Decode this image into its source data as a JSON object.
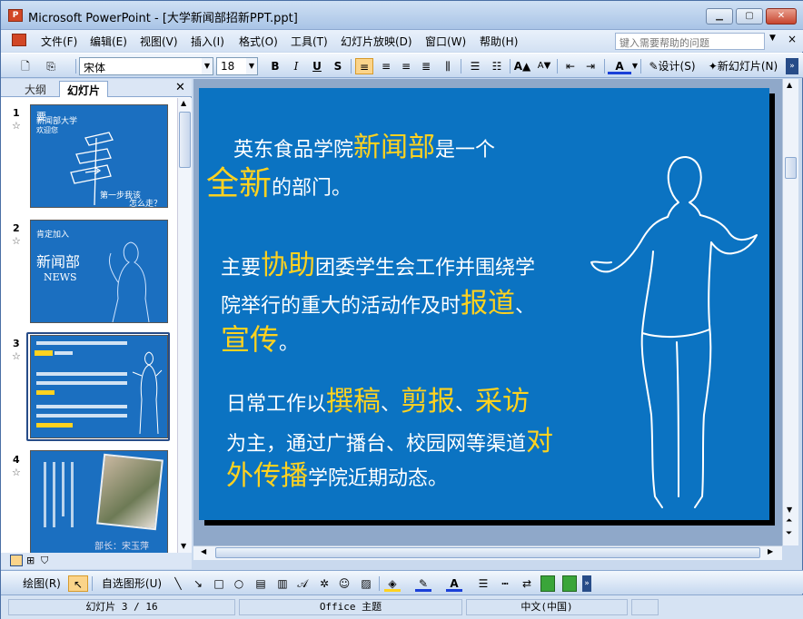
{
  "window": {
    "title": "Microsoft PowerPoint - [大学新闻部招新PPT.ppt]",
    "app_icon": "P"
  },
  "menu": {
    "items": [
      "文件(F)",
      "编辑(E)",
      "视图(V)",
      "插入(I)",
      "格式(O)",
      "工具(T)",
      "幻灯片放映(D)",
      "窗口(W)",
      "帮助(H)"
    ],
    "help_placeholder": "键入需要帮助的问题"
  },
  "toolbar": {
    "font": "宋体",
    "size": "18",
    "design": "设计(S)",
    "new_slide": "新幻灯片(N)"
  },
  "panel": {
    "tab_outline": "大纲",
    "tab_slides": "幻灯片"
  },
  "thumbs": {
    "t1_top": "要",
    "t1_line1": "新闻部大学",
    "t1_line2": "欢迎您",
    "t1_bottom1": "第一步我该",
    "t1_bottom2": "怎么走？",
    "t2_top": "肯定加入",
    "t2_big": "新闻部",
    "t2_sub": "NEWS",
    "t4_caption": "部长：宋玉萍",
    "nums": [
      "1",
      "2",
      "3",
      "4"
    ]
  },
  "slide": {
    "l1a": "英东食品学院",
    "l1b": "新闻部",
    "l1c": "是一个",
    "l2a": "全新",
    "l2b": "的部门。",
    "p2a": "主要",
    "p2b": "协助",
    "p2c": "团委学生会工作并围绕学",
    "p2d": "院举行的重大的活动作及时",
    "p2e": "报道",
    "p2f": "、",
    "p2g": "宣传",
    "p2h": "。",
    "p3a": "日常工作以",
    "p3b": "撰稿",
    "p3c": "、",
    "p3d": "剪报",
    "p3e": "、",
    "p3f": "采访",
    "p3g": "为主，通过广播台、校园网等渠道",
    "p3h": "对",
    "p3i": "外传播",
    "p3j": "学院近期动态。"
  },
  "drawbar": {
    "draw": "绘图(R)",
    "autoshapes": "自选图形(U)"
  },
  "status": {
    "slide": "幻灯片 3 / 16",
    "theme": "Office 主题",
    "lang": "中文(中国)"
  }
}
